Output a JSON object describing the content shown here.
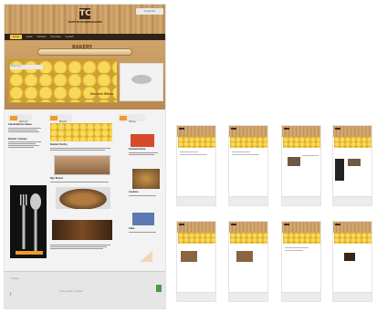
{
  "header": {
    "logo_mark": "TC",
    "logo_text": "ТАНТЕ ИСЛАНДИЯ БАКЕРИ",
    "social": "facebook"
  },
  "nav": {
    "items": [
      "Home",
      "About",
      "Products",
      "Franchise",
      "Contact"
    ]
  },
  "hero": {
    "title": "BAKERY",
    "label": "Welcome",
    "product_label": "Danish Bites"
  },
  "columns": {
    "col1": {
      "heading1": "Celebrations Cakes",
      "heading2": "Danish Cookies",
      "tab": "About"
    },
    "col2": {
      "heading1": "Danish Pastry",
      "heading2": "Rye Bread",
      "tab": "News"
    },
    "col3": {
      "heading1": "Pumpernickel",
      "heading2": "Cookies",
      "heading3": "Cake",
      "tab": "Shop"
    }
  },
  "footer": {
    "copyright": "© Tante",
    "links": "Home | About | Contact"
  },
  "colors": {
    "accent": "#f19a2b",
    "honey": "#f4c542",
    "dark": "#2f2216"
  },
  "icons": [
    "fork-icon",
    "spoon-icon",
    "facebook-icon",
    "logo-icon"
  ]
}
